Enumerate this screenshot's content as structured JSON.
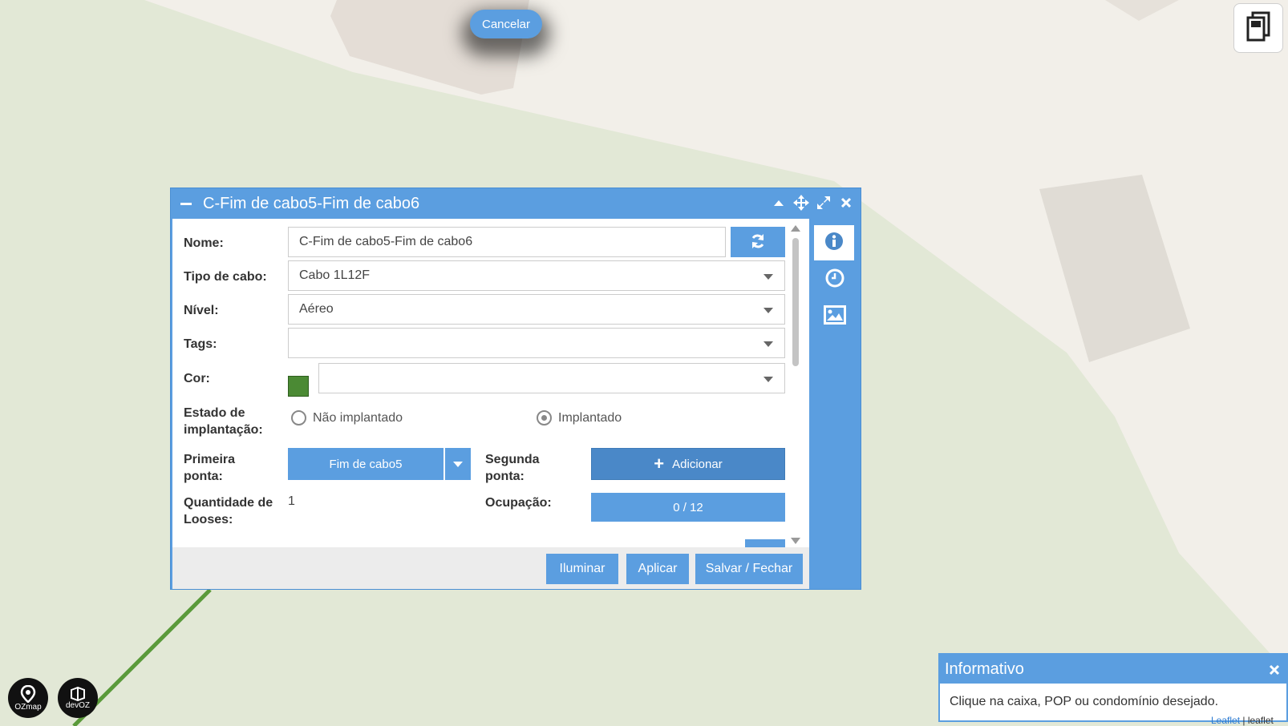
{
  "map": {
    "cancel_label": "Cancelar",
    "attribution_link": "Leaflet",
    "attribution_sep": " | ",
    "attribution_text": "leaflet",
    "logos": [
      "OZmap",
      "devOZ"
    ]
  },
  "dialog": {
    "title": "C-Fim de cabo5-Fim de cabo6",
    "fields": {
      "nome_label": "Nome:",
      "nome_value": "C-Fim de cabo5-Fim de cabo6",
      "tipo_label": "Tipo de cabo:",
      "tipo_value": "Cabo 1L12F",
      "nivel_label": "Nível:",
      "nivel_value": "Aéreo",
      "tags_label": "Tags:",
      "tags_value": "",
      "cor_label": "Cor:",
      "cor_value": "",
      "cor_color": "#4b8a34",
      "estado_label_1": "Estado de",
      "estado_label_2": "implantação:",
      "estado_option_1": "Não implantado",
      "estado_option_2": "Implantado",
      "estado_selected": "Implantado",
      "primeira_label_1": "Primeira",
      "primeira_label_2": "ponta:",
      "primeira_value": "Fim de cabo5",
      "segunda_label_1": "Segunda",
      "segunda_label_2": "ponta:",
      "segunda_button": "Adicionar",
      "looses_label_1": "Quantidade de",
      "looses_label_2": "Looses:",
      "looses_value": "1",
      "ocupacao_label": "Ocupação:",
      "ocupacao_value": "0 / 12"
    },
    "footer": {
      "iluminar": "Iluminar",
      "aplicar": "Aplicar",
      "salvar": "Salvar / Fechar"
    },
    "side_tabs": [
      "info-icon",
      "clock-icon",
      "image-icon"
    ]
  },
  "info_panel": {
    "title": "Informativo",
    "message": "Clique na caixa, POP ou condomínio desejado."
  },
  "colors": {
    "accent": "#5b9ee0",
    "cable_green": "#5a9a3a",
    "annotation_red": "#e8242a"
  }
}
